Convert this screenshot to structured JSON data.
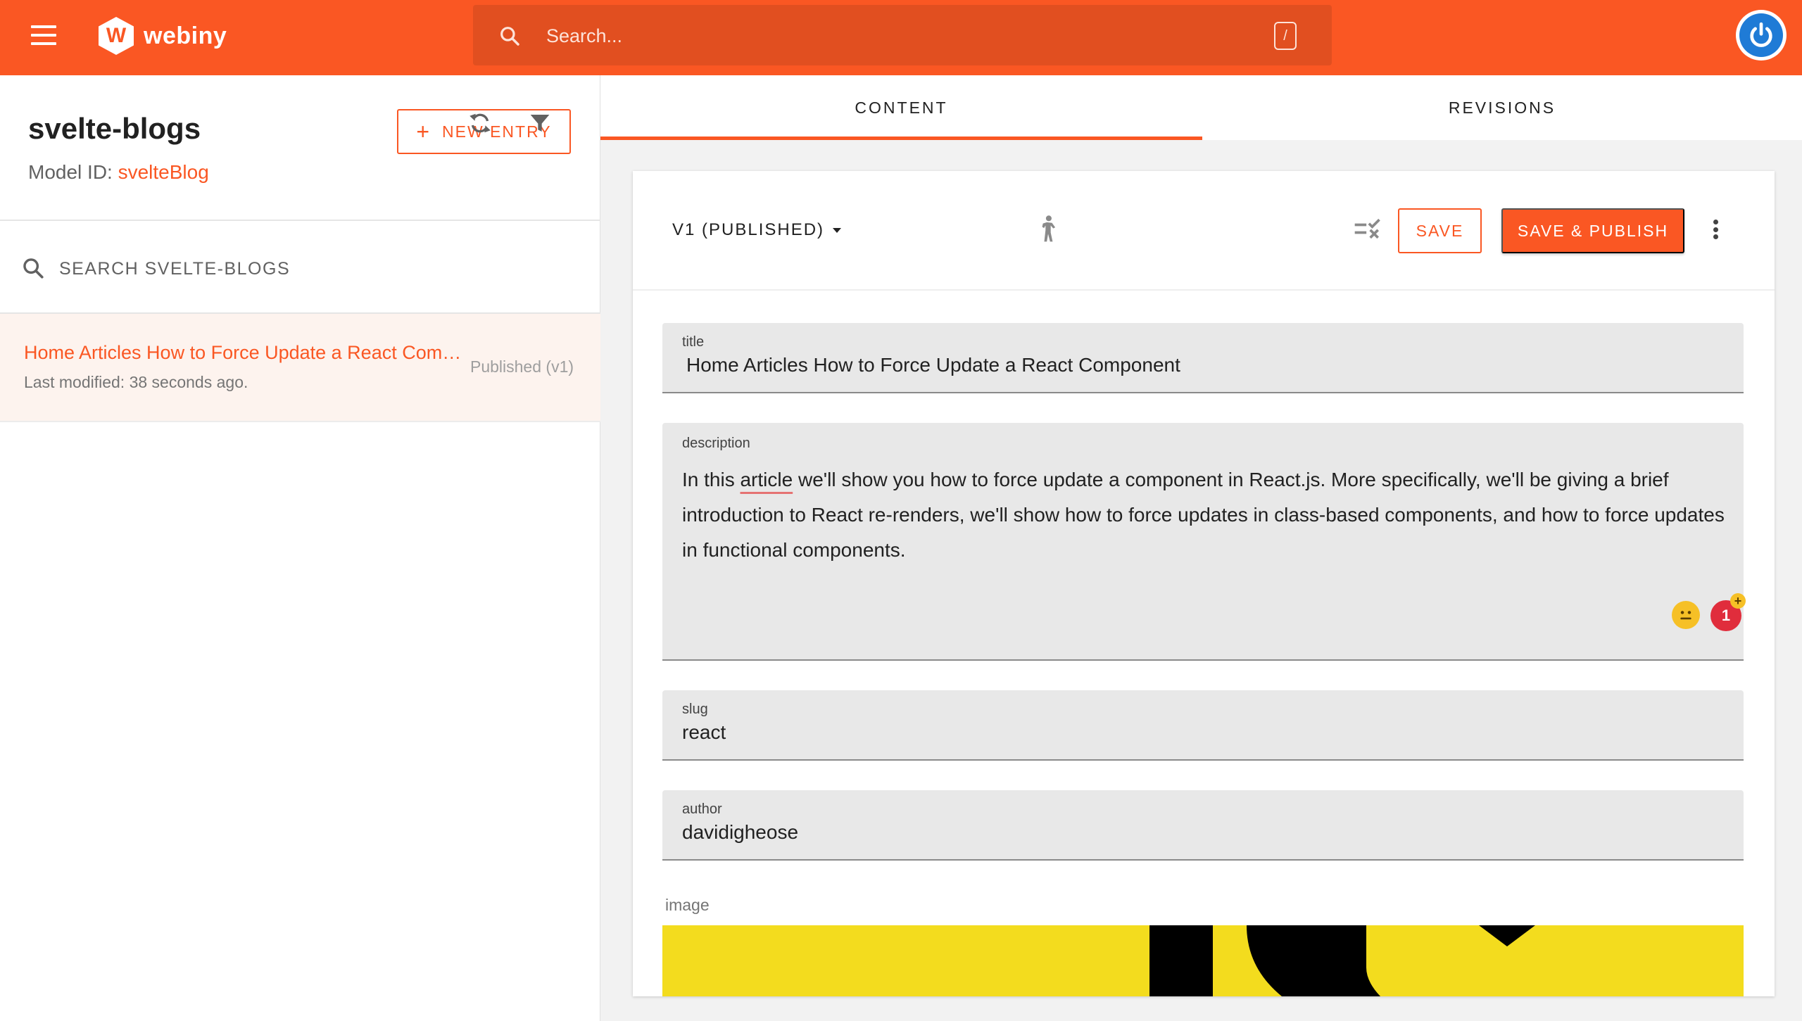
{
  "topbar": {
    "logo_text": "webiny",
    "logo_letter": "W",
    "search_placeholder": "Search...",
    "search_shortcut": "/"
  },
  "left_panel": {
    "model_title": "svelte-blogs",
    "model_id_label": "Model ID:",
    "model_id_value": "svelteBlog",
    "new_entry_label": "NEW ENTRY",
    "search_label": "SEARCH SVELTE-BLOGS",
    "entries": [
      {
        "title": "Home Articles How to Force Update a React Component",
        "modified": "Last modified: 38 seconds ago.",
        "status": "Published (v1)"
      }
    ]
  },
  "tabs": [
    {
      "label": "CONTENT",
      "active": true
    },
    {
      "label": "REVISIONS",
      "active": false
    }
  ],
  "editor": {
    "version_label": "V1 (PUBLISHED)",
    "save_label": "SAVE",
    "save_publish_label": "SAVE & PUBLISH",
    "fields": {
      "title": {
        "label": "title",
        "value": "Home Articles How to Force Update a React Component"
      },
      "description": {
        "label": "description",
        "value_before": "In this ",
        "value_marked": "article",
        "value_after": " we'll show you how to force update a component in React.js. More specifically, we'll be giving a brief introduction to React re-renders, we'll show how to force updates in class-based components, and how to force updates in functional components."
      },
      "slug": {
        "label": "slug",
        "value": "react"
      },
      "author": {
        "label": "author",
        "value": "davidigheose"
      },
      "image": {
        "label": "image"
      }
    },
    "grammar_count": "1",
    "grammar_plus": "+"
  },
  "colors": {
    "brand": "#fa5723",
    "avatar_blue": "#1f7bd6",
    "field_bg": "#e8e8e8",
    "image_yellow": "#f3dc1e"
  },
  "icons": [
    "menu-icon",
    "search-icon",
    "refresh-icon",
    "filter-icon",
    "plus-icon",
    "caret-down-icon",
    "person-icon",
    "checklist-icon",
    "more-vert-icon",
    "power-icon",
    "emoji-icon"
  ]
}
